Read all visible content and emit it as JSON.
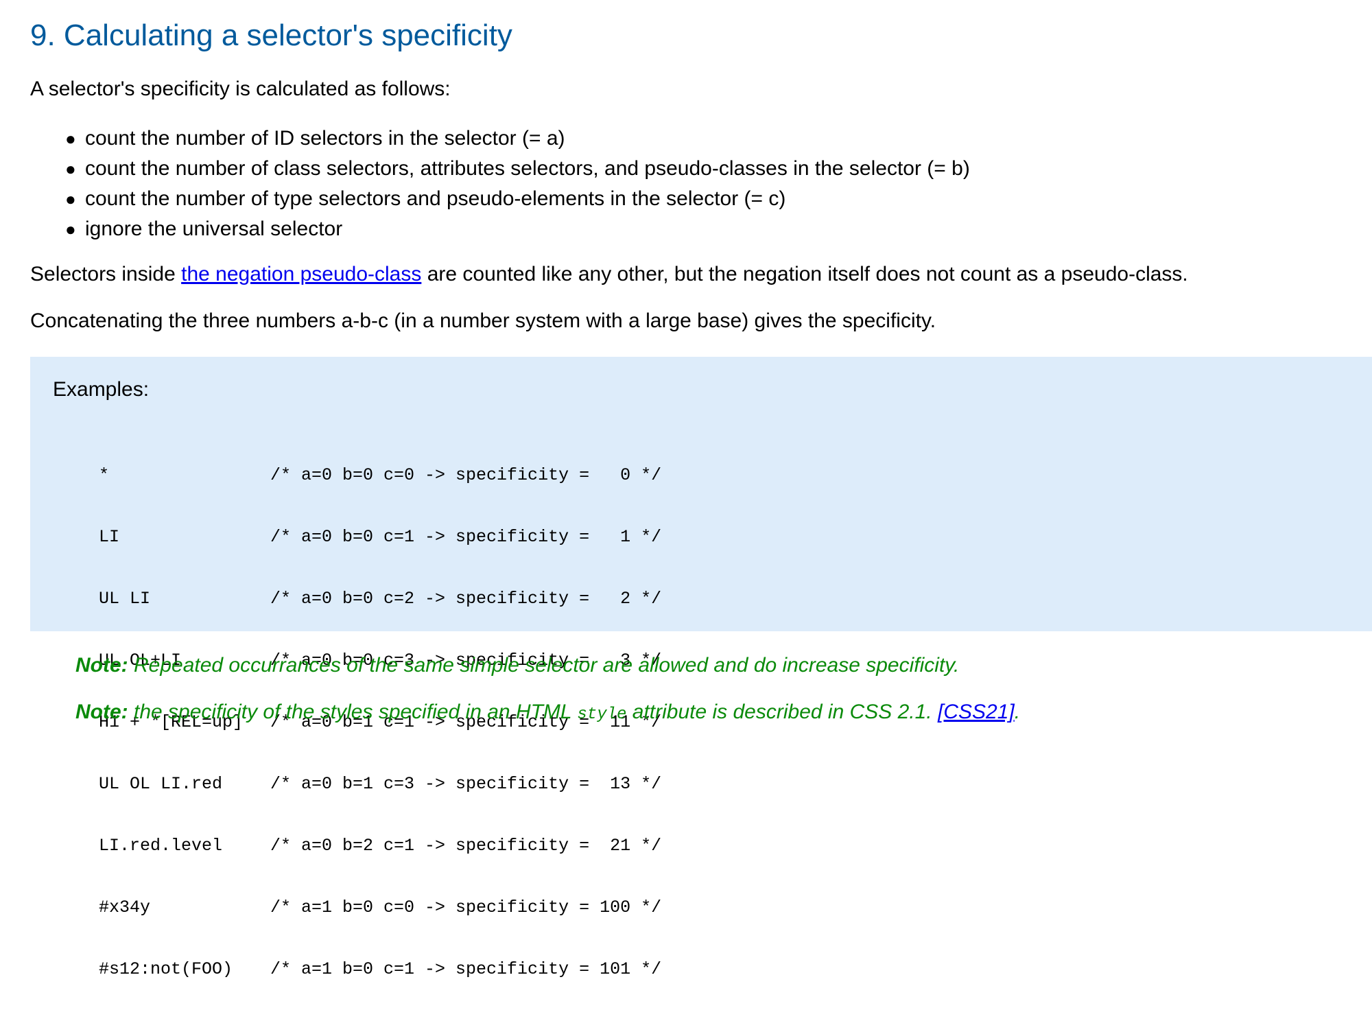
{
  "section": {
    "title": "9. Calculating a selector's specificity"
  },
  "intro": "A selector's specificity is calculated as follows:",
  "rules": [
    "count the number of ID selectors in the selector (= a)",
    "count the number of class selectors, attributes selectors, and pseudo-classes in the selector (= b)",
    "count the number of type selectors and pseudo-elements in the selector (= c)",
    "ignore the universal selector"
  ],
  "negation_paragraph": {
    "before": "Selectors inside ",
    "link": "the negation pseudo-class",
    "after": " are counted like any other, but the negation itself does not count as a pseudo-class."
  },
  "concat_paragraph": "Concatenating the three numbers a-b-c (in a number system with a large base) gives the specificity.",
  "examples": {
    "heading": "Examples:",
    "rows": [
      {
        "selector": "*",
        "calc": "/* a=0 b=0 c=0 -> specificity =   0 */"
      },
      {
        "selector": "LI",
        "calc": "/* a=0 b=0 c=1 -> specificity =   1 */"
      },
      {
        "selector": "UL LI",
        "calc": "/* a=0 b=0 c=2 -> specificity =   2 */"
      },
      {
        "selector": "UL OL+LI",
        "calc": "/* a=0 b=0 c=3 -> specificity =   3 */"
      },
      {
        "selector": "H1 + *[REL=up]",
        "calc": "/* a=0 b=1 c=1 -> specificity =  11 */"
      },
      {
        "selector": "UL OL LI.red",
        "calc": "/* a=0 b=1 c=3 -> specificity =  13 */"
      },
      {
        "selector": "LI.red.level",
        "calc": "/* a=0 b=2 c=1 -> specificity =  21 */"
      },
      {
        "selector": "#x34y",
        "calc": "/* a=1 b=0 c=0 -> specificity = 100 */"
      },
      {
        "selector": "#s12:not(FOO)",
        "calc": "/* a=1 b=0 c=1 -> specificity = 101 */"
      }
    ]
  },
  "notes": {
    "label": "Note:",
    "note1": " Repeated occurrances of the same simple selector are allowed and do increase specificity.",
    "note2_before": " the specificity of the styles specified in an HTML ",
    "note2_code": "style",
    "note2_middle": " attribute is described in CSS 2.1. ",
    "note2_link": "[CSS21]",
    "note2_after": "."
  },
  "colors": {
    "heading": "#005a9c",
    "example_background": "#ddecfa",
    "note_text": "#0a8a0a",
    "link": "#0000ee"
  }
}
